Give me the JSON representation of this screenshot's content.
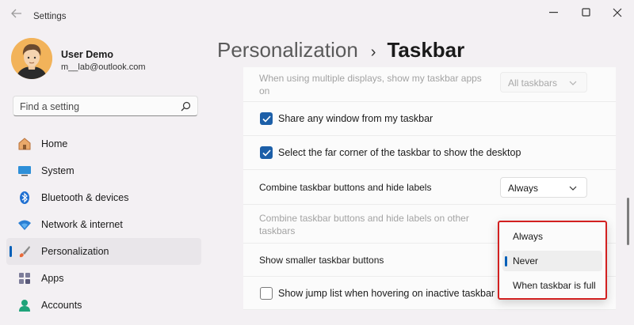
{
  "window": {
    "title": "Settings"
  },
  "user": {
    "name": "User Demo",
    "email": "m__lab@outlook.com"
  },
  "search": {
    "placeholder": "Find a setting"
  },
  "sidebar": {
    "items": [
      {
        "label": "Home",
        "icon": "home-icon"
      },
      {
        "label": "System",
        "icon": "system-icon"
      },
      {
        "label": "Bluetooth & devices",
        "icon": "bluetooth-icon"
      },
      {
        "label": "Network & internet",
        "icon": "network-icon"
      },
      {
        "label": "Personalization",
        "icon": "brush-icon",
        "active": true
      },
      {
        "label": "Apps",
        "icon": "apps-icon"
      },
      {
        "label": "Accounts",
        "icon": "accounts-icon"
      }
    ]
  },
  "breadcrumb": {
    "parent": "Personalization",
    "separator": "›",
    "current": "Taskbar"
  },
  "settings": {
    "multi_display": {
      "label": "When using multiple displays, show my taskbar apps on",
      "value": "All taskbars",
      "disabled": true
    },
    "share_window": {
      "label": "Share any window from my taskbar",
      "checked": true
    },
    "far_corner": {
      "label": "Select the far corner of the taskbar to show the desktop",
      "checked": true
    },
    "combine": {
      "label": "Combine taskbar buttons and hide labels",
      "value": "Always"
    },
    "combine_other": {
      "label": "Combine taskbar buttons and hide labels on other taskbars",
      "disabled": true
    },
    "smaller_buttons": {
      "label": "Show smaller taskbar buttons"
    },
    "jump_list": {
      "label": "Show jump list when hovering on inactive taskbar app",
      "checked": false
    }
  },
  "dropdown_menu": {
    "options": [
      "Always",
      "Never",
      "When taskbar is full"
    ],
    "selected": "Never"
  },
  "colors": {
    "accent": "#005fb8",
    "checkbox": "#1c5fa8",
    "highlight_box": "#d22020",
    "window_bg": "#f3f0f3",
    "card_bg": "#fbfbfb"
  }
}
